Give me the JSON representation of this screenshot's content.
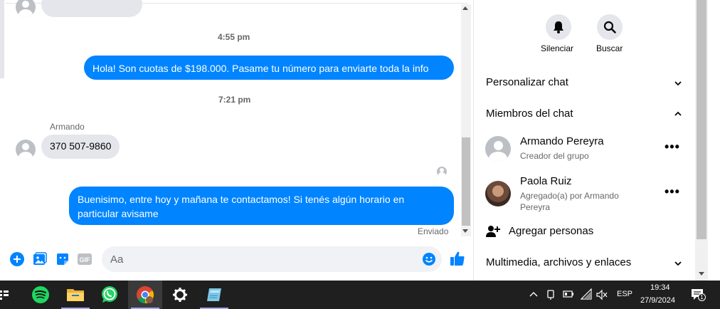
{
  "messages": {
    "time1": "4:55 pm",
    "out1": "Hola! Son cuotas de $198.000. Pasame tu número para enviarte toda la info",
    "time2": "7:21 pm",
    "sender_name": "Armando",
    "in1": "370 507-9860",
    "out2": "Buenisimo, entre hoy y mañana te contactamos! Si tenés algún horario en particular avisame",
    "status": "Enviado"
  },
  "composer": {
    "placeholder": "Aa"
  },
  "right_panel": {
    "mute_label": "Silenciar",
    "search_label": "Buscar",
    "customize_chat": "Personalizar chat",
    "chat_members": "Miembros del chat",
    "members": [
      {
        "name": "Armando Pereyra",
        "sub": "Creador del grupo"
      },
      {
        "name": "Paola Ruiz",
        "sub": "Agregado(a) por Armando Pereyra"
      }
    ],
    "add_people": "Agregar personas",
    "media_files_links": "Multimedia, archivos y enlaces"
  },
  "taskbar": {
    "apps": [
      "spotify",
      "file-explorer",
      "whatsapp",
      "chrome",
      "settings",
      "notes"
    ],
    "language": "ESP",
    "time": "19:34",
    "date": "27/9/2024",
    "notifications": "1"
  },
  "colors": {
    "accent": "#0084ff",
    "bubble_in": "#e4e6eb",
    "taskbar": "#1f1f1f"
  }
}
